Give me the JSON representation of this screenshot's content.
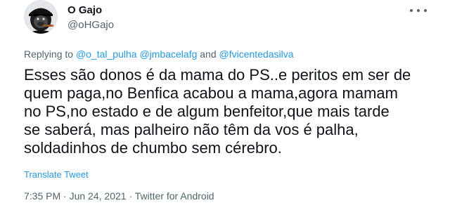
{
  "author": {
    "display_name": "O Gajo",
    "handle": "@oHGajo",
    "avatar_icon": "gorilla-smoking-avatar"
  },
  "more_icon": "more-horizontal-icon",
  "replying": {
    "prefix": "Replying to",
    "mentions": [
      "@o_tal_pulha",
      "@jmbacelafg"
    ],
    "joiner": "and",
    "last_mention": "@fvicentedasilva"
  },
  "tweet": {
    "lines": [
      "Esses são donos é da mama do PS..e peritos em ser de",
      "quem paga,no Benfica acabou a mama,agora mamam",
      "no PS,no estado e de algum benfeitor,que mais tarde",
      "se saberá, mas palheiro não têm da vos é palha,",
      "soldadinhos de chumbo sem cérebro."
    ]
  },
  "translate_label": "Translate Tweet",
  "meta": {
    "time": "7:35 PM",
    "separator": "·",
    "date": "Jun 24, 2021",
    "source": "Twitter for Android"
  },
  "colors": {
    "link": "#1d9bf0",
    "secondary_text": "#536471",
    "primary_text": "#0f1419"
  }
}
